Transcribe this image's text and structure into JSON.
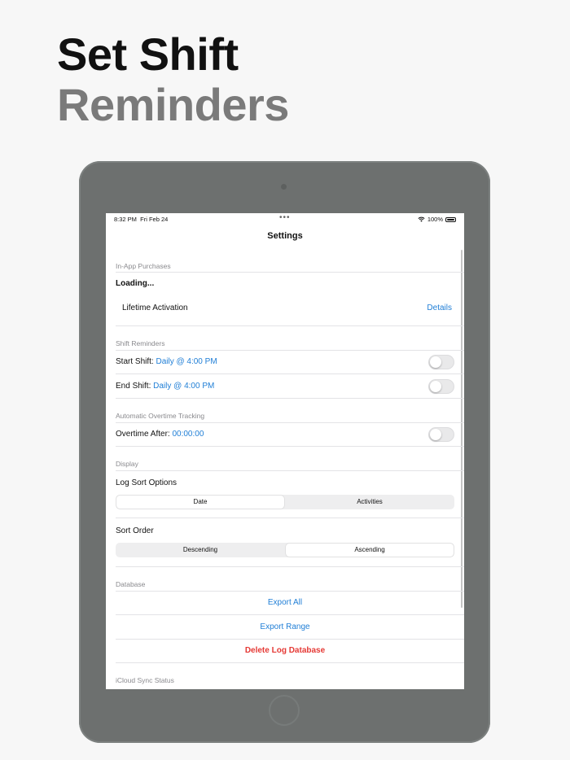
{
  "headline": {
    "line1": "Set Shift",
    "line2": "Reminders"
  },
  "status_bar": {
    "time": "8:32 PM",
    "date": "Fri Feb 24",
    "dots": "•••",
    "battery": "100%"
  },
  "nav": {
    "title": "Settings"
  },
  "iap": {
    "header": "In-App Purchases",
    "loading": "Loading...",
    "lifetime_label": "Lifetime Activation",
    "details_link": "Details"
  },
  "shift_reminders": {
    "header": "Shift Reminders",
    "start_label": "Start Shift: ",
    "start_value": "Daily @ 4:00 PM",
    "start_enabled": false,
    "end_label": "End Shift: ",
    "end_value": "Daily @ 4:00 PM",
    "end_enabled": false
  },
  "overtime": {
    "header": "Automatic Overtime Tracking",
    "label": "Overtime After: ",
    "value": "00:00:00",
    "enabled": false
  },
  "display": {
    "header": "Display",
    "log_sort_label": "Log Sort Options",
    "log_sort_options": [
      "Date",
      "Activities"
    ],
    "log_sort_selected": "Date",
    "sort_order_label": "Sort Order",
    "sort_order_options": [
      "Descending",
      "Ascending"
    ],
    "sort_order_selected": "Ascending"
  },
  "database": {
    "header": "Database",
    "export_all": "Export All",
    "export_range": "Export Range",
    "delete_log": "Delete Log Database"
  },
  "icloud": {
    "header": "iCloud Sync Status"
  },
  "colors": {
    "accent": "#1f7ed6",
    "destructive": "#e53935",
    "device": "#6d706f"
  }
}
